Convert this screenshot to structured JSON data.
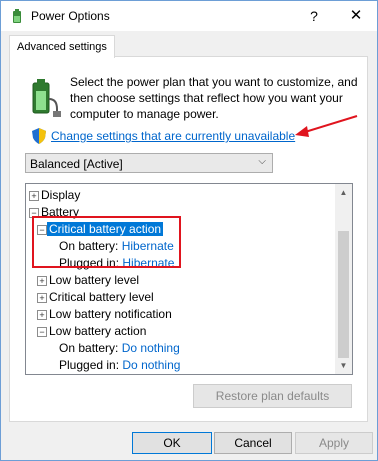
{
  "window": {
    "title": "Power Options",
    "help_label": "?",
    "close_label": "✕"
  },
  "tab": {
    "label": "Advanced settings"
  },
  "description": "Select the power plan that you want to customize, and then choose settings that reflect how you want your computer to manage power.",
  "change_settings_link": "Change settings that are currently unavailable",
  "plan_select": {
    "value": "Balanced [Active]"
  },
  "tree": {
    "display": "Display",
    "battery": "Battery",
    "critical_battery_action": "Critical battery action",
    "critical_on_battery_label": "On battery:",
    "critical_on_battery_value": "Hibernate",
    "critical_plugged_in_label": "Plugged in:",
    "critical_plugged_in_value": "Hibernate",
    "low_battery_level": "Low battery level",
    "critical_battery_level": "Critical battery level",
    "low_battery_notification": "Low battery notification",
    "low_battery_action": "Low battery action",
    "low_on_battery_label": "On battery:",
    "low_on_battery_value": "Do nothing",
    "low_plugged_in_label": "Plugged in:",
    "low_plugged_in_value": "Do nothing"
  },
  "buttons": {
    "restore": "Restore plan defaults",
    "ok": "OK",
    "cancel": "Cancel",
    "apply": "Apply"
  },
  "colors": {
    "accent": "#0078d7",
    "link": "#0066cc",
    "annotation": "#e0141e"
  }
}
